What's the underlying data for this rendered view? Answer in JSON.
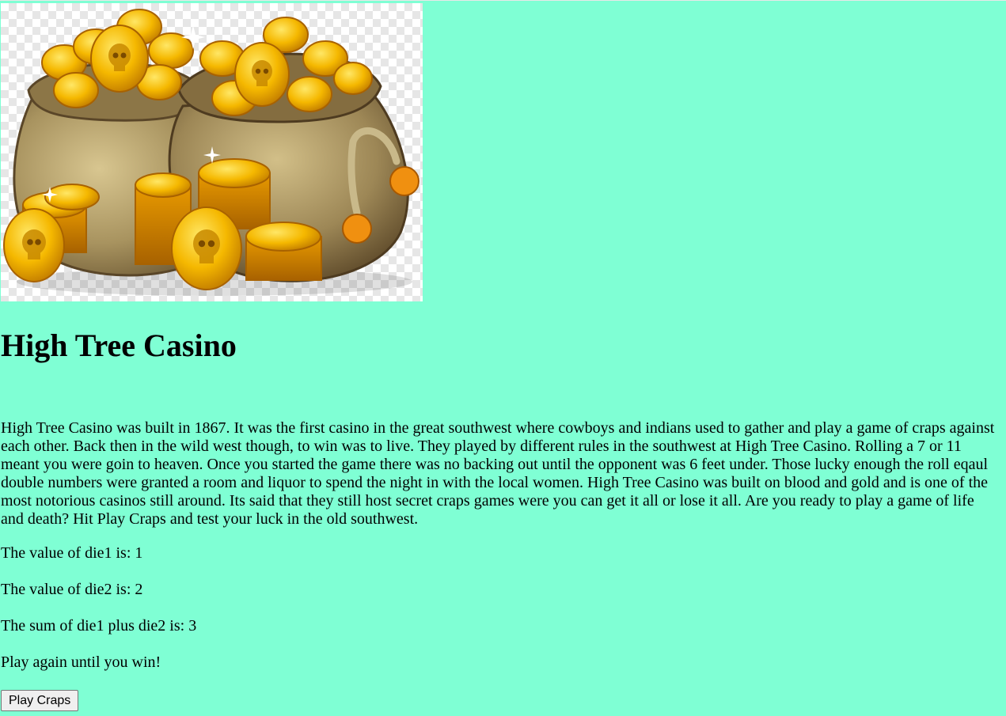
{
  "header": {
    "title": "High Tree Casino"
  },
  "hero_image": {
    "alt": "Bags of gold skull coins",
    "icon": "gold-coin-bags-icon"
  },
  "intro": "High Tree Casino was built in 1867. It was the first casino in the great southwest where cowboys and indians used to gather and play a game of craps against each other. Back then in the wild west though, to win was to live. They played by different rules in the southwest at High Tree Casino. Rolling a 7 or 11 meant you were goin to heaven. Once you started the game there was no backing out until the opponent was 6 feet under. Those lucky enough the roll eqaul double numbers were granted a room and liquor to spend the night in with the local women. High Tree Casino was built on blood and gold and is one of the most notorious casinos still around. Its said that they still host secret craps games were you can get it all or lose it all. Are you ready to play a game of life and death? Hit Play Craps and test your luck in the old southwest.",
  "results": {
    "die1": "The value of die1 is: 1",
    "die2": "The value of die2 is: 2",
    "sum": "The sum of die1 plus die2 is: 3",
    "message": "Play again until you win!"
  },
  "button": {
    "label": "Play Craps"
  },
  "colors": {
    "background": "#7fffd4",
    "gold": "#f5b800",
    "sack": "#a8935f"
  }
}
